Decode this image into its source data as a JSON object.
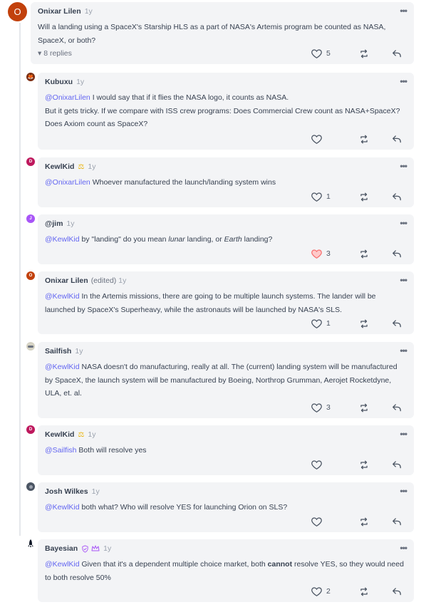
{
  "colors": {
    "accent": "#6366f1",
    "bubble": "#f3f4f6",
    "liked": "#f87171"
  },
  "root": {
    "avatar_letter": "O",
    "author": "Onixar Lilen",
    "time": "1y",
    "text": "Will a landing using a SpaceX's Starship HLS as a part of NASA's Artemis program be counted as NASA, SpaceX, or both?",
    "replies_label": "▾ 8 replies",
    "likes": "5"
  },
  "replies": [
    {
      "avatar_letter": "",
      "author": "Kubuxu",
      "time": "1y",
      "mention": "@OnixarLilen",
      "text1": " I would say that if it flies the NASA logo, it counts as NASA.",
      "text2": "But it gets tricky. If we compare with ISS crew programs: Does Commercial Crew count as NASA+SpaceX? Does Axiom count as SpaceX?",
      "likes": ""
    },
    {
      "avatar_letter": "D",
      "author": "KewlKid",
      "time": "1y",
      "mention": "@OnixarLilen",
      "text1": " Whoever manufactured the launch/landing system wins",
      "likes": "1"
    },
    {
      "avatar_letter": "J",
      "author": "@jim",
      "time": "1y",
      "mention": "@KewlKid",
      "text1": " by \"landing\" do you mean ",
      "em1": "lunar",
      "text1b": " landing, or ",
      "em2": "Earth",
      "text1c": " landing?",
      "likes": "3"
    },
    {
      "avatar_letter": "O",
      "author": "Onixar Lilen",
      "edited": "(edited)",
      "time": "1y",
      "mention": "@KewlKid",
      "text1": " In the Artemis missions, there are going to be multiple launch systems. The lander will be launched by SpaceX's Superheavy, while the astronauts will be launched by NASA's SLS.",
      "likes": "1"
    },
    {
      "avatar_letter": "",
      "author": "Sailfish",
      "time": "1y",
      "mention": "@KewlKid",
      "text1": " NASA doesn't do manufacturing, really at all. The (current) landing system will be manufactured by SpaceX, the launch system will be manufactured by Boeing, Northrop Grumman, Aerojet Rocketdyne, ULA, et. al.",
      "likes": "3"
    },
    {
      "avatar_letter": "D",
      "author": "KewlKid",
      "time": "1y",
      "mention": "@Sailfish",
      "text1": " Both will resolve yes",
      "likes": ""
    },
    {
      "avatar_letter": "",
      "author": "Josh Wilkes",
      "time": "1y",
      "mention": "@KewlKid",
      "text1": " both what? Who will resolve YES for launching Orion on SLS?",
      "likes": ""
    },
    {
      "avatar_letter": "",
      "author": "Bayesian",
      "time": "1y",
      "mention": "@KewlKid",
      "text1": " Given that it's a dependent multiple choice market, both ",
      "bold1": "cannot",
      "text1b": " resolve YES, so they would need to both resolve 50%",
      "likes": "2"
    }
  ]
}
